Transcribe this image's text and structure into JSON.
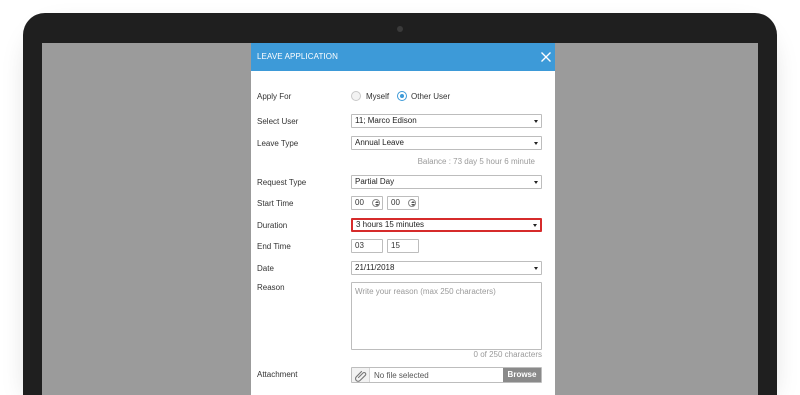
{
  "dialog": {
    "title": "LEAVE APPLICATION",
    "close_icon": "close-icon"
  },
  "form": {
    "apply_for": {
      "label": "Apply For",
      "options": [
        "Myself",
        "Other User"
      ],
      "selected": "Other User"
    },
    "select_user": {
      "label": "Select User",
      "value": "11; Marco Edison"
    },
    "leave_type": {
      "label": "Leave Type",
      "value": "Annual Leave"
    },
    "balance": "Balance : 73 day 5 hour 6 minute",
    "request_type": {
      "label": "Request Type",
      "value": "Partial Day"
    },
    "start_time": {
      "label": "Start Time",
      "hour": "00",
      "minute": "00"
    },
    "duration": {
      "label": "Duration",
      "value": "3 hours 15 minutes",
      "highlight_color": "#d62b2b"
    },
    "end_time": {
      "label": "End Time",
      "hour": "03",
      "minute": "15"
    },
    "date": {
      "label": "Date",
      "value": "21/11/2018"
    },
    "reason": {
      "label": "Reason",
      "placeholder": "Write your reason (max 250 characters)",
      "count": "0 of 250 characters"
    },
    "attachment": {
      "label": "Attachment",
      "file_text": "No file selected",
      "browse_label": "Browse",
      "icon": "paperclip-icon"
    }
  },
  "colors": {
    "header": "#3d9ad8",
    "overlay": "#9b9b9b",
    "browse": "#8a8a8a"
  }
}
